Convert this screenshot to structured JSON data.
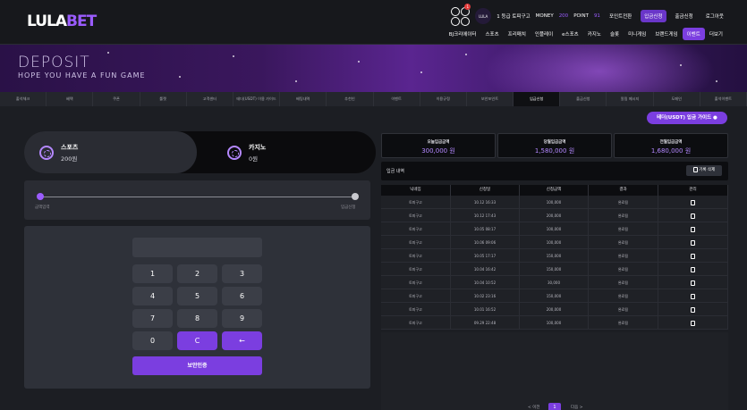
{
  "header": {
    "logo_main": "LULA",
    "logo_accent": "BET",
    "notif_count": "1",
    "badge_text": "LULA",
    "user_label": "1 등급 토피구고",
    "money_label": "MONEY",
    "money_value": "200",
    "point_label": "POINT",
    "point_value": "91",
    "top_buttons": [
      "포인트전환",
      "입금신청",
      "출금신청",
      "로그아웃"
    ],
    "nav": [
      "BJ크리에이터",
      "스포츠",
      "프리매치",
      "인플레이",
      "e스포츠",
      "카지노",
      "슬롯",
      "미니게임",
      "브랜드게임",
      "이벤트",
      "더보기"
    ]
  },
  "banner": {
    "title": "DEPOSIT",
    "subtitle": "HOPE YOU HAVE A FUN GAME"
  },
  "subnav": [
    "출석체크",
    "혜택",
    "쿠폰",
    "룰렛",
    "고객센터",
    "테더(USDT) 이용 가이드",
    "배팅내역",
    "추천인",
    "이벤트",
    "이용규정",
    "보안포인트",
    "입금신청",
    "출금신청",
    "알림 메시지",
    "도메인",
    "출석이벤트"
  ],
  "guide_button": "테더(USDT) 입금 가이드 ●",
  "wallet": {
    "sports_label": "스포츠",
    "sports_value": "200원",
    "casino_label": "카지노",
    "casino_value": "0원"
  },
  "progress": {
    "left_label": "금액입력",
    "right_label": "입금신청"
  },
  "keypad": {
    "keys": [
      "1",
      "2",
      "3",
      "4",
      "5",
      "6",
      "7",
      "8",
      "9",
      "0",
      "C",
      "←"
    ],
    "confirm": "보안인증"
  },
  "stats": [
    {
      "title": "오늘입금금액",
      "value": "300,000 원"
    },
    {
      "title": "당월입금금액",
      "value": "1,580,000 원"
    },
    {
      "title": "전월입금금액",
      "value": "1,680,000 원"
    }
  ],
  "history": {
    "title": "입금 내역",
    "delete_label": "기록 삭제",
    "columns": [
      "닉네임",
      "신청일",
      "신청금액",
      "결과",
      "관리"
    ],
    "rows": [
      [
        "토피구고",
        "10.12 16:33",
        "100,000",
        "완료됨"
      ],
      [
        "토피구고",
        "10.12 17:43",
        "200,000",
        "완료됨"
      ],
      [
        "토피구고",
        "10.05 08:17",
        "100,000",
        "완료됨"
      ],
      [
        "토피구고",
        "10.06 09:06",
        "100,000",
        "완료됨"
      ],
      [
        "토피구고",
        "10.05 17:17",
        "150,000",
        "완료됨"
      ],
      [
        "토피구고",
        "10.04 16:42",
        "150,000",
        "완료됨"
      ],
      [
        "토피구고",
        "10.04 10:52",
        "30,000",
        "완료됨"
      ],
      [
        "토피구고",
        "10.02 23:16",
        "150,000",
        "완료됨"
      ],
      [
        "토피구고",
        "10.01 16:52",
        "200,000",
        "완료됨"
      ],
      [
        "토피구고",
        "09.29 22:48",
        "100,000",
        "완료됨"
      ]
    ]
  },
  "pager": {
    "prev": "< 이전",
    "current": "1",
    "next": "다음 >"
  },
  "colors": {
    "accent": "#7b3ee0",
    "accent_light": "#b488ff"
  }
}
